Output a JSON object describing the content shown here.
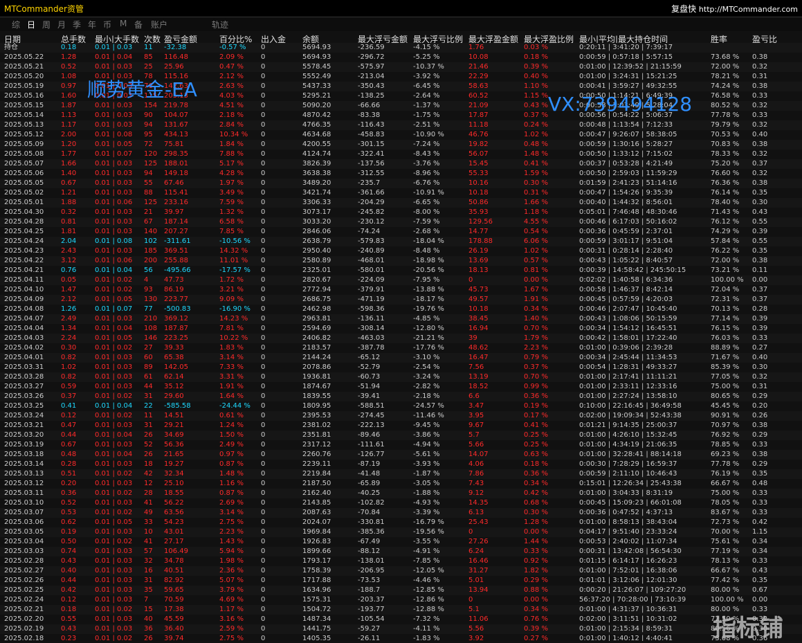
{
  "window": {
    "title": "MTCommander资管",
    "right_label": "复盘快",
    "url": "http://MTCommander.com"
  },
  "tabs": [
    "综",
    "日",
    "周",
    "月",
    "季",
    "年",
    "币",
    "M",
    "备",
    "账户",
    "轨迹"
  ],
  "active_tab": "日",
  "headers": [
    "日期",
    "总手数",
    "最小|大手数",
    "次数",
    "盈亏金额",
    "百分比%",
    "出入金",
    "余额",
    "最大浮亏金额",
    "最大浮亏比例",
    "最大浮盈金额",
    "最大浮盈比例",
    "最小|平均|最大持仓时间",
    "胜率",
    "盈亏比"
  ],
  "summary_row": {
    "label": "持仓",
    "cells": [
      "0.18",
      "0.01 | 0.03",
      "11",
      "-32.38",
      "-0.57 %",
      "0",
      "5694.93",
      "-236.59",
      "-4.15 %",
      "1.76",
      "0.03 %",
      "0:20:11 | 3:41:20 | 7:39:17",
      "",
      ""
    ]
  },
  "rows": [
    [
      "2025.05.22",
      "1.28",
      "0.01 | 0.04",
      "85",
      "116.48",
      "2.09 %",
      "0",
      "5694.93",
      "-296.72",
      "-5.25 %",
      "10.08",
      "0.18 %",
      "0:00:59 | 0:57:18 | 5:57:15",
      "73.68 %",
      "0.38"
    ],
    [
      "2025.05.21",
      "0.52",
      "0.01 | 0.03",
      "25",
      "25.96",
      "0.47 %",
      "0",
      "5578.45",
      "-575.97",
      "-10.37 %",
      "21.46",
      "0.39 %",
      "0:01:00 | 12:39:52 | 21:15:59",
      "72.00 %",
      "0.32"
    ],
    [
      "2025.05.20",
      "1.08",
      "0.01 | 0.03",
      "78",
      "115.16",
      "2.12 %",
      "0",
      "5552.49",
      "-213.04",
      "-3.92 %",
      "22.29",
      "0.40 %",
      "0:01:00 | 3:24:31 | 15:21:25",
      "78.21 %",
      "0.31"
    ],
    [
      "2025.05.19",
      "0.97",
      "0.01 | 0.03",
      "76",
      "142.63",
      "2.63 %",
      "0",
      "5437.33",
      "-350.43",
      "-6.45 %",
      "58.63",
      "1.10 %",
      "0:00:41 | 3:59:27 | 49:32:55",
      "74.24 %",
      "0.38"
    ],
    [
      "2025.05.16",
      "1.60",
      "0.01 | 0.03",
      "115",
      "205.13",
      "4.03 %",
      "0",
      "5295.21",
      "-138.25",
      "-2.64 %",
      "60.52",
      "1.15 %",
      "0:00:50 | 1:14:21 | 6:49:39",
      "76.58 %",
      "0.33"
    ],
    [
      "2025.05.15",
      "1.87",
      "0.01 | 0.03",
      "154",
      "219.78",
      "4.51 %",
      "0",
      "5090.20",
      "-66.66",
      "-1.37 %",
      "21.09",
      "0.43 %",
      "0:00:58 | 1:03:49 | 5:28:04",
      "80.52 %",
      "0.32"
    ],
    [
      "2025.05.14",
      "1.13",
      "0.01 | 0.03",
      "90",
      "104.07",
      "2.18 %",
      "0",
      "4870.42",
      "-83.38",
      "-1.75 %",
      "17.87",
      "0.37 %",
      "0:00:56 | 0:54:22 | 5:06:37",
      "77.78 %",
      "0.33"
    ],
    [
      "2025.05.13",
      "1.17",
      "0.01 | 0.03",
      "94",
      "131.67",
      "2.84 %",
      "0",
      "4766.35",
      "-116.43",
      "-2.51 %",
      "11.18",
      "0.24 %",
      "0:00:48 | 1:13:54 | 7:12:33",
      "79.79 %",
      "0.32"
    ],
    [
      "2025.05.12",
      "2.00",
      "0.01 | 0.08",
      "95",
      "434.13",
      "10.34 %",
      "0",
      "4634.68",
      "-458.83",
      "-10.90 %",
      "46.76",
      "1.02 %",
      "0:00:47 | 9:26:07 | 58:38:05",
      "70.53 %",
      "0.40"
    ],
    [
      "2025.05.09",
      "1.20",
      "0.01 | 0.05",
      "72",
      "75.81",
      "1.84 %",
      "0",
      "4200.55",
      "-301.15",
      "-7.24 %",
      "19.82",
      "0.48 %",
      "0:00:59 | 1:30:16 | 5:28:27",
      "70.83 %",
      "0.38"
    ],
    [
      "2025.05.08",
      "1.77",
      "0.01 | 0.07",
      "120",
      "298.35",
      "7.88 %",
      "0",
      "4124.74",
      "-322.41",
      "-8.43 %",
      "56.07",
      "1.48 %",
      "0:00:50 | 1:33:12 | 7:15:02",
      "78.33 %",
      "0.32"
    ],
    [
      "2025.05.07",
      "1.66",
      "0.01 | 0.03",
      "125",
      "188.01",
      "5.17 %",
      "0",
      "3826.39",
      "-137.56",
      "-3.76 %",
      "15.45",
      "0.41 %",
      "0:00:37 | 0:53:28 | 4:21:49",
      "75.20 %",
      "0.37"
    ],
    [
      "2025.05.06",
      "1.40",
      "0.01 | 0.03",
      "94",
      "149.18",
      "4.28 %",
      "0",
      "3638.38",
      "-312.55",
      "-8.96 %",
      "55.33",
      "1.59 %",
      "0:00:50 | 2:59:03 | 11:59:29",
      "76.60 %",
      "0.32"
    ],
    [
      "2025.05.05",
      "0.67",
      "0.01 | 0.03",
      "55",
      "67.46",
      "1.97 %",
      "0",
      "3489.20",
      "-235.7",
      "-6.76 %",
      "10.16",
      "0.30 %",
      "0:01:59 | 2:41:23 | 51:14:16",
      "76.36 %",
      "0.38"
    ],
    [
      "2025.05.02",
      "1.21",
      "0.01 | 0.03",
      "88",
      "115.41",
      "3.49 %",
      "0",
      "3421.74",
      "-361.66",
      "-10.91 %",
      "10.18",
      "0.31 %",
      "0:00:47 | 1:54:26 | 9:35:39",
      "76.14 %",
      "0.35"
    ],
    [
      "2025.05.01",
      "1.88",
      "0.01 | 0.06",
      "125",
      "233.16",
      "7.59 %",
      "0",
      "3306.33",
      "-204.29",
      "-6.65 %",
      "50.86",
      "1.66 %",
      "0:00:40 | 1:44:32 | 8:56:01",
      "78.40 %",
      "0.30"
    ],
    [
      "2025.04.30",
      "0.32",
      "0.01 | 0.03",
      "21",
      "39.97",
      "1.32 %",
      "0",
      "3073.17",
      "-245.82",
      "-8.00 %",
      "35.93",
      "1.18 %",
      "0:05:01 | 7:46:48 | 48:30:46",
      "71.43 %",
      "0.43"
    ],
    [
      "2025.04.28",
      "0.81",
      "0.01 | 0.03",
      "67",
      "187.14",
      "6.58 %",
      "0",
      "3033.20",
      "-230.12",
      "-7.59 %",
      "129.56",
      "4.55 %",
      "0:00:46 | 6:17:03 | 50:16:02",
      "76.12 %",
      "0.55"
    ],
    [
      "2025.04.25",
      "1.81",
      "0.01 | 0.03",
      "140",
      "207.27",
      "7.85 %",
      "0",
      "2846.06",
      "-74.24",
      "-2.68 %",
      "14.77",
      "0.54 %",
      "0:00:36 | 0:45:59 | 2:37:01",
      "74.29 %",
      "0.39"
    ],
    [
      "2025.04.24",
      "2.04",
      "0.01 | 0.08",
      "102",
      "-311.61",
      "-10.56 %",
      "0",
      "2638.79",
      "-579.83",
      "-18.04 %",
      "178.88",
      "6.06 %",
      "0:00:59 | 3:01:17 | 9:51:04",
      "57.84 %",
      "0.55"
    ],
    [
      "2025.04.23",
      "2.43",
      "0.01 | 0.03",
      "185",
      "369.51",
      "14.32 %",
      "0",
      "2950.40",
      "-240.89",
      "-8.48 %",
      "26.19",
      "1.02 %",
      "0:00:31 | 0:28:14 | 2:28:40",
      "76.22 %",
      "0.35"
    ],
    [
      "2025.04.22",
      "3.12",
      "0.01 | 0.06",
      "200",
      "255.88",
      "11.01 %",
      "0",
      "2580.89",
      "-468.01",
      "-18.98 %",
      "13.69",
      "0.57 %",
      "0:00:43 | 1:05:22 | 8:40:57",
      "72.00 %",
      "0.38"
    ],
    [
      "2025.04.21",
      "0.76",
      "0.01 | 0.04",
      "56",
      "-495.66",
      "-17.57 %",
      "0",
      "2325.01",
      "-580.01",
      "-20.56 %",
      "18.13",
      "0.81 %",
      "0:00:39 | 14:58:42 | 245:50:15",
      "73.21 %",
      "0.11"
    ],
    [
      "2025.04.11",
      "0.05",
      "0.01 | 0.02",
      "4",
      "47.73",
      "1.72 %",
      "0",
      "2820.67",
      "-224.09",
      "-7.95 %",
      "0",
      "0.00 %",
      "0:02:02 | 1:40:58 | 6:34:36",
      "100.00 %",
      "0.00"
    ],
    [
      "2025.04.10",
      "1.47",
      "0.01 | 0.02",
      "93",
      "86.19",
      "3.21 %",
      "0",
      "2772.94",
      "-379.91",
      "-13.88 %",
      "45.73",
      "1.67 %",
      "0:00:58 | 1:46:37 | 8:42:14",
      "72.04 %",
      "0.37"
    ],
    [
      "2025.04.09",
      "2.12",
      "0.01 | 0.05",
      "130",
      "223.77",
      "9.09 %",
      "0",
      "2686.75",
      "-471.19",
      "-18.17 %",
      "49.57",
      "1.91 %",
      "0:00:45 | 0:57:59 | 4:20:03",
      "72.31 %",
      "0.37"
    ],
    [
      "2025.04.08",
      "1.26",
      "0.01 | 0.07",
      "77",
      "-500.83",
      "-16.90 %",
      "0",
      "2462.98",
      "-598.36",
      "-19.76 %",
      "10.18",
      "0.34 %",
      "0:00:46 | 2:07:47 | 10:45:40",
      "70.13 %",
      "0.28"
    ],
    [
      "2025.04.07",
      "2.49",
      "0.01 | 0.03",
      "210",
      "369.12",
      "14.23 %",
      "0",
      "2963.81",
      "-136.11",
      "-4.85 %",
      "38.45",
      "1.40 %",
      "0:00:43 | 1:08:06 | 50:15:59",
      "77.14 %",
      "0.39"
    ],
    [
      "2025.04.04",
      "1.34",
      "0.01 | 0.04",
      "108",
      "187.87",
      "7.81 %",
      "0",
      "2594.69",
      "-308.14",
      "-12.80 %",
      "16.94",
      "0.70 %",
      "0:00:34 | 1:54:12 | 16:45:51",
      "76.15 %",
      "0.39"
    ],
    [
      "2025.04.03",
      "2.24",
      "0.01 | 0.05",
      "146",
      "223.25",
      "10.22 %",
      "0",
      "2406.82",
      "-463.03",
      "-21.21 %",
      "39",
      "1.79 %",
      "0:00:42 | 1:58:01 | 17:22:40",
      "76.03 %",
      "0.33"
    ],
    [
      "2025.04.02",
      "0.30",
      "0.01 | 0.02",
      "27",
      "39.33",
      "1.83 %",
      "0",
      "2183.57",
      "-387.78",
      "-17.76 %",
      "48.62",
      "2.23 %",
      "0:01:00 | 0:39:06 | 2:39:28",
      "88.89 %",
      "0.27"
    ],
    [
      "2025.04.01",
      "0.82",
      "0.01 | 0.03",
      "60",
      "65.38",
      "3.14 %",
      "0",
      "2144.24",
      "-65.12",
      "-3.10 %",
      "16.47",
      "0.79 %",
      "0:00:34 | 2:45:44 | 11:34:53",
      "71.67 %",
      "0.40"
    ],
    [
      "2025.03.31",
      "1.02",
      "0.01 | 0.03",
      "89",
      "142.05",
      "7.33 %",
      "0",
      "2078.86",
      "-52.79",
      "-2.54 %",
      "7.56",
      "0.37 %",
      "0:00:54 | 1:28:31 | 49:33:27",
      "85.39 %",
      "0.30"
    ],
    [
      "2025.03.28",
      "0.82",
      "0.01 | 0.03",
      "61",
      "62.14",
      "3.31 %",
      "0",
      "1936.81",
      "-60.73",
      "-3.24 %",
      "13.19",
      "0.70 %",
      "0:01:00 | 2:17:41 | 11:11:21",
      "77.05 %",
      "0.32"
    ],
    [
      "2025.03.27",
      "0.59",
      "0.01 | 0.03",
      "44",
      "35.12",
      "1.91 %",
      "0",
      "1874.67",
      "-51.94",
      "-2.82 %",
      "18.52",
      "0.99 %",
      "0:01:00 | 2:33:11 | 12:33:16",
      "75.00 %",
      "0.31"
    ],
    [
      "2025.03.26",
      "0.37",
      "0.01 | 0.02",
      "31",
      "29.60",
      "1.64 %",
      "0",
      "1839.55",
      "-39.41",
      "-2.18 %",
      "6.6",
      "0.36 %",
      "0:01:00 | 2:27:24 | 13:58:10",
      "80.65 %",
      "0.29"
    ],
    [
      "2025.03.25",
      "0.41",
      "0.01 | 0.04",
      "22",
      "-585.58",
      "-24.44 %",
      "0",
      "1809.95",
      "-588.51",
      "-24.57 %",
      "3.47",
      "0.19 %",
      "0:10:00 | 22:16:45 | 36:49:58",
      "45.45 %",
      "0.20"
    ],
    [
      "2025.03.24",
      "0.12",
      "0.01 | 0.02",
      "11",
      "14.51",
      "0.61 %",
      "0",
      "2395.53",
      "-274.45",
      "-11.46 %",
      "3.95",
      "0.17 %",
      "0:02:00 | 19:09:34 | 52:43:38",
      "90.91 %",
      "0.26"
    ],
    [
      "2025.03.21",
      "0.47",
      "0.01 | 0.03",
      "31",
      "29.21",
      "1.24 %",
      "0",
      "2381.02",
      "-222.13",
      "-9.45 %",
      "9.67",
      "0.41 %",
      "0:01:21 | 9:14:35 | 25:00:37",
      "70.97 %",
      "0.38"
    ],
    [
      "2025.03.20",
      "0.44",
      "0.01 | 0.04",
      "26",
      "34.69",
      "1.50 %",
      "0",
      "2351.81",
      "-89.46",
      "-3.86 %",
      "5.7",
      "0.25 %",
      "0:01:00 | 4:26:10 | 15:32:45",
      "76.92 %",
      "0.29"
    ],
    [
      "2025.03.19",
      "0.67",
      "0.01 | 0.03",
      "52",
      "56.36",
      "2.49 %",
      "0",
      "2317.12",
      "-111.61",
      "-4.94 %",
      "5.66",
      "0.25 %",
      "0:01:00 | 4:34:19 | 21:06:35",
      "78.85 %",
      "0.33"
    ],
    [
      "2025.03.18",
      "0.48",
      "0.01 | 0.04",
      "26",
      "21.65",
      "0.97 %",
      "0",
      "2260.76",
      "-126.77",
      "-5.61 %",
      "14.07",
      "0.63 %",
      "0:01:00 | 32:28:41 | 88:14:18",
      "69.23 %",
      "0.38"
    ],
    [
      "2025.03.14",
      "0.28",
      "0.01 | 0.03",
      "18",
      "19.27",
      "0.87 %",
      "0",
      "2239.11",
      "-87.19",
      "-3.93 %",
      "4.06",
      "0.18 %",
      "0:00:30 | 7:28:29 | 16:59:37",
      "77.78 %",
      "0.29"
    ],
    [
      "2025.03.13",
      "0.51",
      "0.01 | 0.02",
      "42",
      "32.34",
      "1.48 %",
      "0",
      "2219.84",
      "-41.48",
      "-1.87 %",
      "7.86",
      "0.36 %",
      "0:00:59 | 2:11:10 | 10:46:43",
      "76.19 %",
      "0.35"
    ],
    [
      "2025.03.12",
      "0.20",
      "0.01 | 0.03",
      "12",
      "25.10",
      "1.16 %",
      "0",
      "2187.50",
      "-65.89",
      "-3.05 %",
      "7.43",
      "0.34 %",
      "0:15:01 | 12:26:34 | 25:43:38",
      "66.67 %",
      "0.48"
    ],
    [
      "2025.03.11",
      "0.36",
      "0.01 | 0.02",
      "28",
      "18.55",
      "0.87 %",
      "0",
      "2162.40",
      "-40.25",
      "-1.88 %",
      "9.12",
      "0.42 %",
      "0:01:00 | 3:04:33 | 8:31:19",
      "75.00 %",
      "0.33"
    ],
    [
      "2025.03.10",
      "0.52",
      "0.01 | 0.03",
      "41",
      "56.22",
      "2.69 %",
      "0",
      "2143.85",
      "-102.82",
      "-4.93 %",
      "14.35",
      "0.68 %",
      "0:00:45 | 15:09:23 | 66:01:08",
      "78.05 %",
      "0.33"
    ],
    [
      "2025.03.07",
      "0.53",
      "0.01 | 0.02",
      "49",
      "63.56",
      "3.14 %",
      "0",
      "2087.63",
      "-70.84",
      "-3.39 %",
      "6.13",
      "0.30 %",
      "0:00:36 | 0:47:52 | 4:37:13",
      "83.67 %",
      "0.33"
    ],
    [
      "2025.03.06",
      "0.62",
      "0.01 | 0.05",
      "33",
      "54.23",
      "2.75 %",
      "0",
      "2024.07",
      "-330.81",
      "-16.79 %",
      "25.43",
      "1.28 %",
      "0:01:00 | 8:58:13 | 38:43:04",
      "72.73 %",
      "0.42"
    ],
    [
      "2025.03.05",
      "0.19",
      "0.01 | 0.03",
      "10",
      "43.01",
      "2.23 %",
      "0",
      "1969.84",
      "-385.36",
      "-19.56 %",
      "0",
      "0.00 %",
      "0:04:17 | 9:51:40 | 23:33:24",
      "70.00 %",
      "1.15"
    ],
    [
      "2025.03.04",
      "0.50",
      "0.01 | 0.02",
      "41",
      "27.17",
      "1.43 %",
      "0",
      "1926.83",
      "-67.49",
      "-3.55 %",
      "27.26",
      "1.44 %",
      "0:00:53 | 2:40:02 | 11:07:34",
      "75.61 %",
      "0.34"
    ],
    [
      "2025.03.03",
      "0.74",
      "0.01 | 0.03",
      "57",
      "106.49",
      "5.94 %",
      "0",
      "1899.66",
      "-88.12",
      "-4.91 %",
      "6.24",
      "0.33 %",
      "0:00:31 | 13:42:08 | 56:54:30",
      "77.19 %",
      "0.34"
    ],
    [
      "2025.02.28",
      "0.43",
      "0.01 | 0.03",
      "32",
      "34.78",
      "1.98 %",
      "0",
      "1793.17",
      "-138.01",
      "-7.85 %",
      "16.46",
      "0.92 %",
      "0:01:15 | 6:14:17 | 16:26:23",
      "78.13 %",
      "0.33"
    ],
    [
      "2025.02.27",
      "0.40",
      "0.01 | 0.03",
      "16",
      "40.51",
      "2.36 %",
      "0",
      "1758.39",
      "-206.95",
      "-12.05 %",
      "31.27",
      "1.82 %",
      "0:01:00 | 7:52:01 | 16:38:06",
      "66.67 %",
      "0.43"
    ],
    [
      "2025.02.26",
      "0.44",
      "0.01 | 0.03",
      "31",
      "82.92",
      "5.07 %",
      "0",
      "1717.88",
      "-73.53",
      "-4.46 %",
      "5.01",
      "0.29 %",
      "0:01:01 | 3:12:06 | 12:01:30",
      "77.42 %",
      "0.35"
    ],
    [
      "2025.02.25",
      "0.42",
      "0.01 | 0.03",
      "35",
      "59.65",
      "3.79 %",
      "0",
      "1634.96",
      "-188.7",
      "-12.85 %",
      "13.94",
      "0.88 %",
      "0:00:20 | 21:26:07 | 109:27:20",
      "80.00 %",
      "0.67"
    ],
    [
      "2025.02.24",
      "0.12",
      "0.01 | 0.03",
      "7",
      "70.59",
      "4.69 %",
      "0",
      "1575.31",
      "-203.37",
      "-12.86 %",
      "0",
      "0.00 %",
      "56:37:20 | 70:28:00 | 73:10:39",
      "100.00 %",
      "0.00"
    ],
    [
      "2025.02.21",
      "0.18",
      "0.01 | 0.02",
      "15",
      "17.38",
      "1.17 %",
      "0",
      "1504.72",
      "-193.77",
      "-12.88 %",
      "5.1",
      "0.34 %",
      "0:01:00 | 4:31:37 | 10:36:31",
      "80.00 %",
      "0.33"
    ],
    [
      "2025.02.20",
      "0.55",
      "0.01 | 0.03",
      "40",
      "45.59",
      "3.16 %",
      "0",
      "1487.34",
      "-105.54",
      "-7.32 %",
      "11.06",
      "0.76 %",
      "0:02:00 | 3:11:51 | 10:31:02",
      "72.50 %",
      "0.32"
    ],
    [
      "2025.02.19",
      "0.43",
      "0.01 | 0.03",
      "36",
      "36.40",
      "2.59 %",
      "0",
      "1441.75",
      "-59.27",
      "-4.11 %",
      "5.56",
      "0.39 %",
      "0:01:00 | 2:15:34 | 8:59:31",
      "80.56 %",
      "0.30"
    ],
    [
      "2025.02.18",
      "0.23",
      "0.01 | 0.02",
      "26",
      "39.74",
      "2.75 %",
      "0",
      "1405.35",
      "-26.11",
      "-1.83 %",
      "3.92",
      "0.27 %",
      "0:01:00 | 1:40:12 | 4:40:41",
      "73.08 %",
      "0.36"
    ]
  ],
  "watermarks": {
    "ea": "顺势黄金-EA",
    "vx": "VX:739494128",
    "logo": "指标铺"
  },
  "colors": {
    "loss": "#ff2a2a",
    "win": "#1ed9ff",
    "title": "#ffd400",
    "watermark": "#2f8fff"
  }
}
